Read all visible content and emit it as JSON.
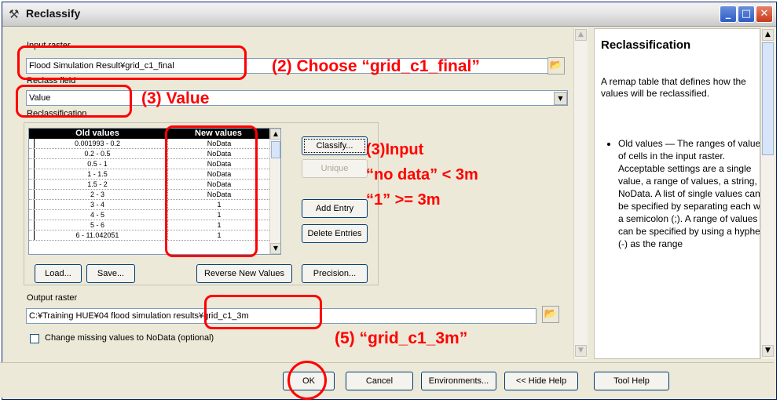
{
  "window": {
    "title": "Reclassify"
  },
  "input_raster": {
    "label": "Input raster",
    "value": "Flood Simulation Result¥grid_c1_final"
  },
  "reclass_field": {
    "label": "Reclass field",
    "value": "Value"
  },
  "reclassification": {
    "label": "Reclassification",
    "headers": {
      "old": "Old values",
      "new": "New values"
    },
    "rows": [
      {
        "old": "0.001993 - 0.2",
        "new": "NoData"
      },
      {
        "old": "0.2 - 0.5",
        "new": "NoData"
      },
      {
        "old": "0.5 - 1",
        "new": "NoData"
      },
      {
        "old": "1 - 1.5",
        "new": "NoData"
      },
      {
        "old": "1.5 - 2",
        "new": "NoData"
      },
      {
        "old": "2 - 3",
        "new": "NoData"
      },
      {
        "old": "3 - 4",
        "new": "1"
      },
      {
        "old": "4 - 5",
        "new": "1"
      },
      {
        "old": "5 - 6",
        "new": "1"
      },
      {
        "old": "6 - 11.042051",
        "new": "1"
      }
    ],
    "buttons": {
      "classify": "Classify...",
      "unique": "Unique",
      "add_entry": "Add Entry",
      "delete_entries": "Delete Entries",
      "load": "Load...",
      "save": "Save...",
      "reverse": "Reverse New Values",
      "precision": "Precision..."
    }
  },
  "output_raster": {
    "label": "Output raster",
    "value": "C:¥Training HUE¥04 flood simulation results¥grid_c1_3m"
  },
  "checkbox_label": "Change missing values to NoData (optional)",
  "footer": {
    "ok": "OK",
    "cancel": "Cancel",
    "environments": "Environments...",
    "hide_help": "<< Hide Help",
    "tool_help": "Tool Help"
  },
  "help": {
    "title": "Reclassification",
    "intro": "A remap table that defines how the values will be reclassified.",
    "bullet": "Old values — The ranges of values of cells in the input raster. Acceptable settings are a single value, a range of values, a string, or NoData. A list of single values can be specified by separating each with a semicolon (;). A range of values can be specified by using a hyphen (-) as the range"
  },
  "annotations": {
    "step2": "(2)  Choose “grid_c1_final”",
    "step3_value": "(3)  Value",
    "step3_input_line1": "(3)Input",
    "step3_input_line2": "“no data” < 3m",
    "step3_input_line3": "“1” >= 3m",
    "step5": "(5)  “grid_c1_3m”",
    "color": "#ff0000"
  }
}
